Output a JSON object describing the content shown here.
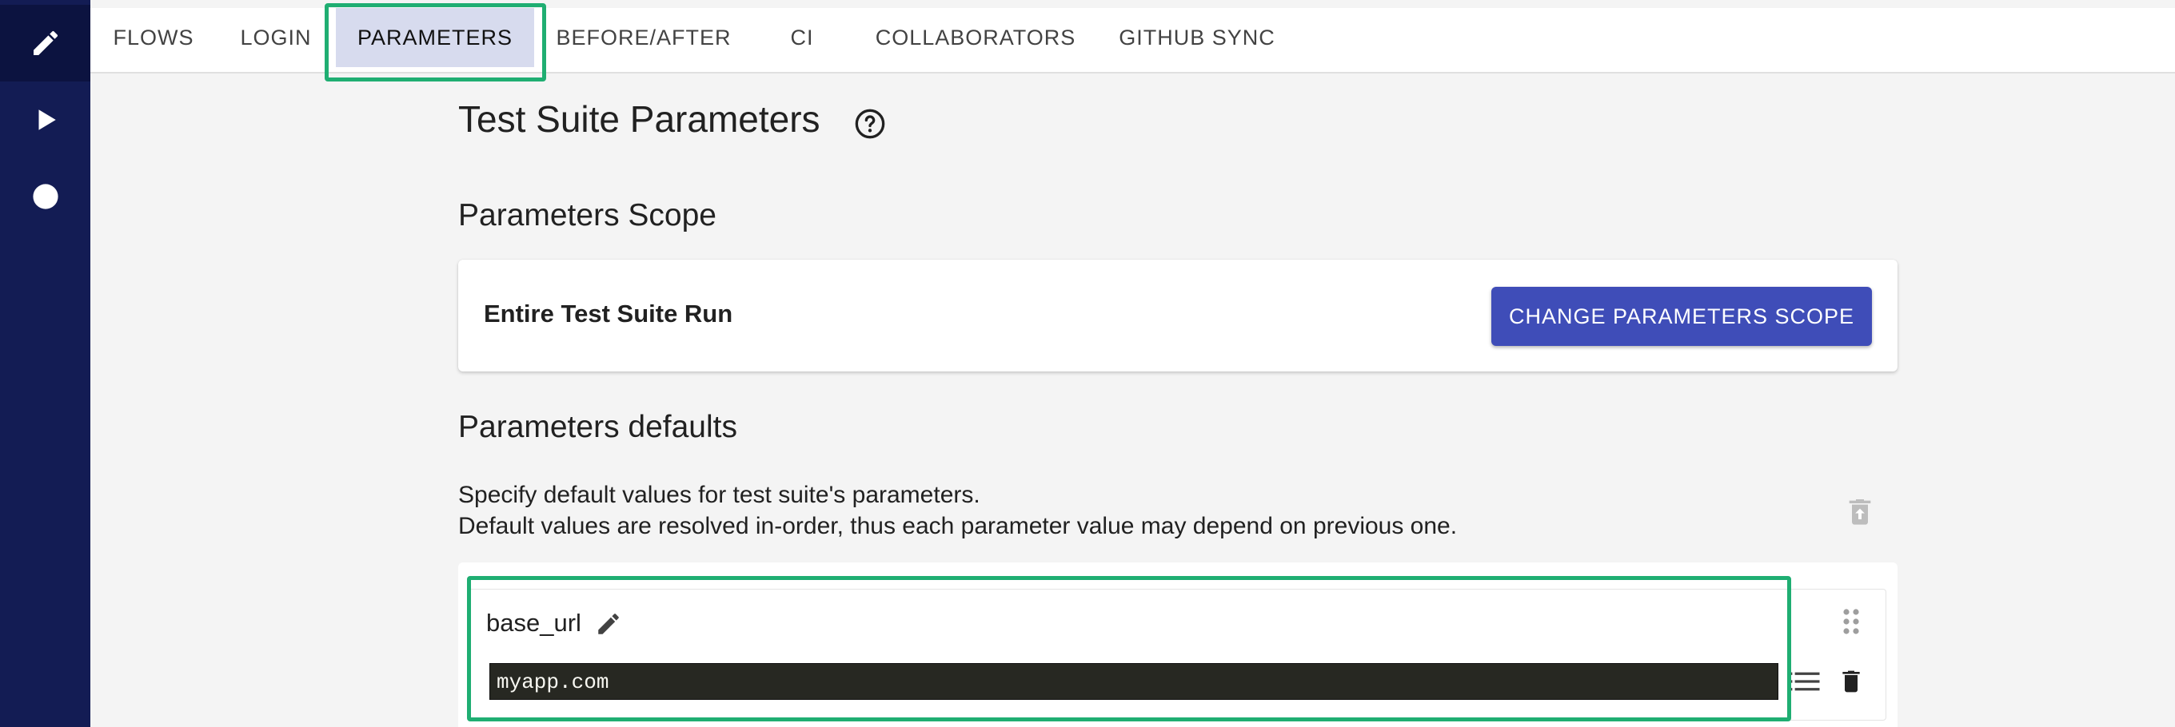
{
  "rail": {
    "items": [
      {
        "icon": "pencil-icon"
      },
      {
        "icon": "play-icon"
      },
      {
        "icon": "record-icon"
      }
    ]
  },
  "tabs": [
    {
      "label": "FLOWS",
      "active": false
    },
    {
      "label": "LOGIN",
      "active": false
    },
    {
      "label": "PARAMETERS",
      "active": true
    },
    {
      "label": "BEFORE/AFTER",
      "active": false
    },
    {
      "label": "CI",
      "active": false
    },
    {
      "label": "COLLABORATORS",
      "active": false
    },
    {
      "label": "GITHUB SYNC",
      "active": false
    }
  ],
  "page": {
    "title": "Test Suite Parameters",
    "help_icon": "help-circle-icon"
  },
  "scope": {
    "heading": "Parameters Scope",
    "current": "Entire Test Suite Run",
    "button_label": "CHANGE PARAMETERS SCOPE"
  },
  "defaults": {
    "heading": "Parameters defaults",
    "description_line1": "Specify default values for test suite's parameters.",
    "description_line2": "Default values are resolved in-order, thus each parameter value may depend on previous one.",
    "parameters": [
      {
        "name": "base_url",
        "value": "myapp.com"
      }
    ]
  },
  "colors": {
    "rail": "#131c54",
    "accent_button": "#3f4db8",
    "active_tab": "#d7dbee",
    "highlight": "#1fae72",
    "code_bg": "#272822"
  }
}
